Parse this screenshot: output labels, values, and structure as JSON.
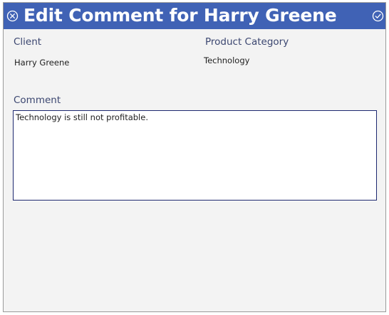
{
  "form": {
    "title": "Edit Comment for Harry Greene",
    "cancel_icon": "close-circle-icon",
    "submit_icon": "check-circle-icon"
  },
  "fields": {
    "client": {
      "label": "Client",
      "value": "Harry Greene"
    },
    "product_category": {
      "label": "Product Category",
      "value": "Technology"
    },
    "comment": {
      "label": "Comment",
      "value": "Technology is still not profitable."
    }
  },
  "colors": {
    "title_bar": "#4062b5",
    "label_text": "#3b4670",
    "input_border": "#1d2870",
    "form_background": "#f3f3f3"
  }
}
